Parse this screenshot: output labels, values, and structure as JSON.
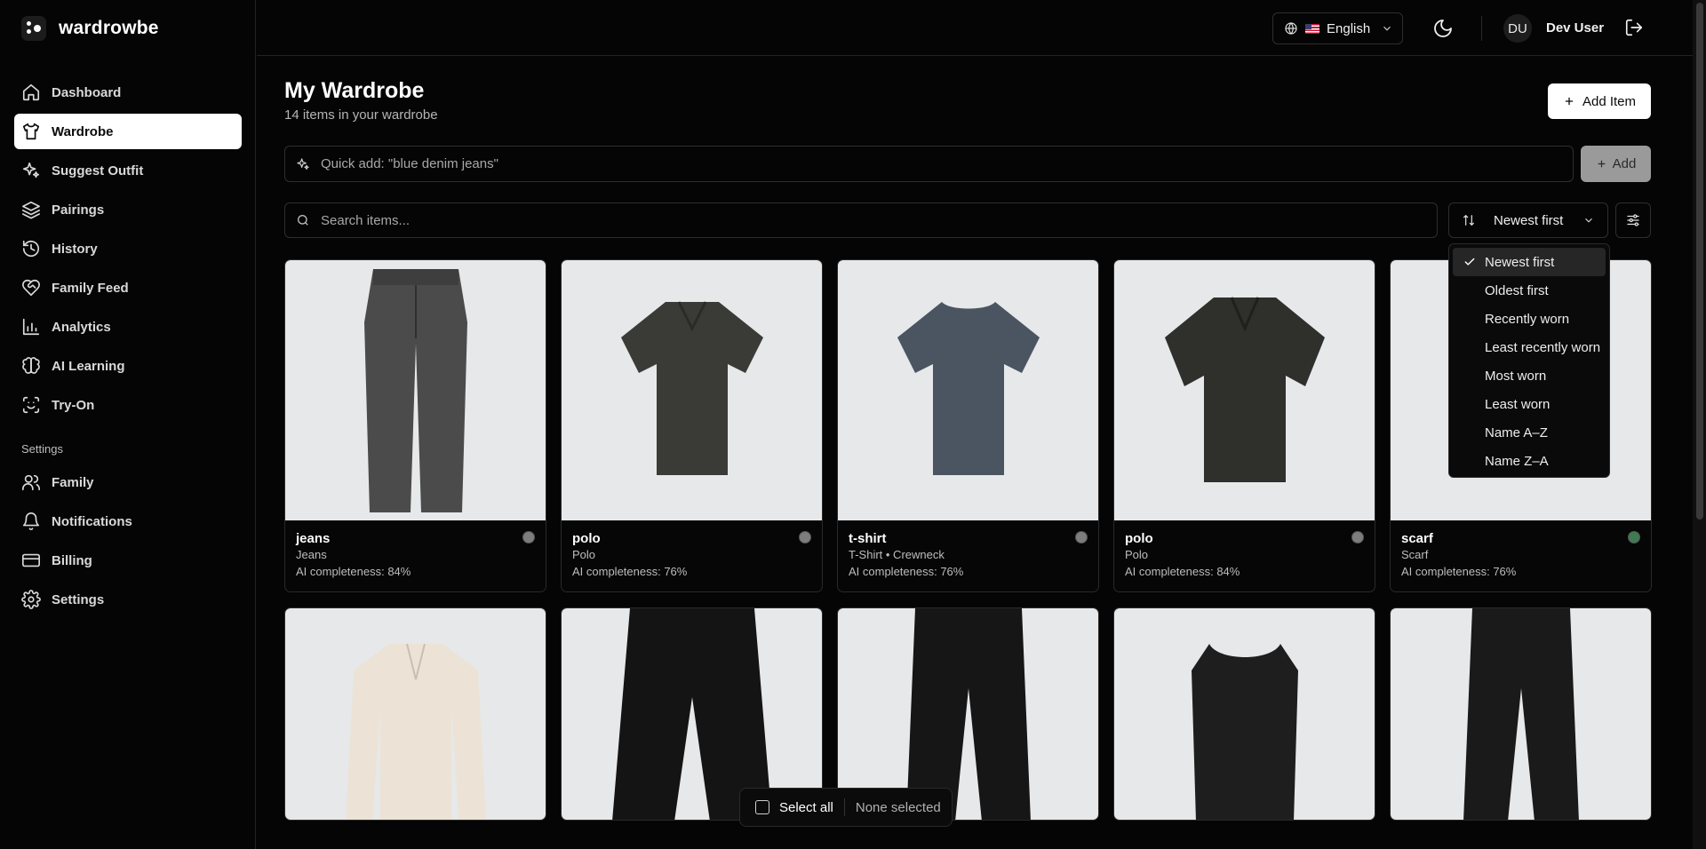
{
  "app": {
    "brand": "wardrowbe"
  },
  "sidebar": {
    "items": [
      {
        "label": "Dashboard",
        "icon": "home-icon"
      },
      {
        "label": "Wardrobe",
        "icon": "shirt-icon",
        "active": true
      },
      {
        "label": "Suggest Outfit",
        "icon": "sparkles-icon"
      },
      {
        "label": "Pairings",
        "icon": "layers-icon"
      },
      {
        "label": "History",
        "icon": "history-icon"
      },
      {
        "label": "Family Feed",
        "icon": "heart-handshake-icon"
      },
      {
        "label": "Analytics",
        "icon": "bar-chart-icon"
      },
      {
        "label": "AI Learning",
        "icon": "brain-icon"
      },
      {
        "label": "Try-On",
        "icon": "scan-face-icon"
      }
    ],
    "settings_heading": "Settings",
    "settings_items": [
      {
        "label": "Family",
        "icon": "users-icon"
      },
      {
        "label": "Notifications",
        "icon": "bell-icon"
      },
      {
        "label": "Billing",
        "icon": "credit-card-icon"
      },
      {
        "label": "Settings",
        "icon": "gear-icon"
      }
    ]
  },
  "topbar": {
    "language": "English",
    "avatar_initials": "DU",
    "user_name": "Dev User"
  },
  "header": {
    "title": "My Wardrobe",
    "subtitle": "14 items in your wardrobe",
    "add_item_label": "Add Item"
  },
  "quick_add": {
    "placeholder": "Quick add: \"blue denim jeans\"",
    "button_label": "Add"
  },
  "search": {
    "placeholder": "Search items..."
  },
  "sort": {
    "selected": "Newest first",
    "options": [
      "Newest first",
      "Oldest first",
      "Recently worn",
      "Least recently worn",
      "Most worn",
      "Least worn",
      "Name A–Z",
      "Name Z–A"
    ]
  },
  "items": [
    {
      "name": "jeans",
      "category": "Jeans",
      "ai": "AI completeness: 84%",
      "status_color": "#7d7d7d",
      "image": "wide-jeans-illustration"
    },
    {
      "name": "polo",
      "category": "Polo",
      "ai": "AI completeness: 76%",
      "status_color": "#7d7d7d",
      "image": "polo-illustration"
    },
    {
      "name": "t-shirt",
      "category": "T-Shirt • Crewneck",
      "ai": "AI completeness: 76%",
      "status_color": "#7d7d7d",
      "image": "tshirt-illustration"
    },
    {
      "name": "polo",
      "category": "Polo",
      "ai": "AI completeness: 84%",
      "status_color": "#7d7d7d",
      "image": "polo-illustration"
    },
    {
      "name": "scarf",
      "category": "Scarf",
      "ai": "AI completeness: 76%",
      "status_color": "#3f7a52",
      "image": "scarf-illustration"
    }
  ],
  "second_row": [
    {
      "image": "sweater-illustration"
    },
    {
      "image": "jeans-illustration"
    },
    {
      "image": "trousers-illustration"
    },
    {
      "image": "tank-top-illustration"
    },
    {
      "image": "joggers-illustration"
    }
  ],
  "selection": {
    "select_all": "Select all",
    "status": "None selected"
  }
}
